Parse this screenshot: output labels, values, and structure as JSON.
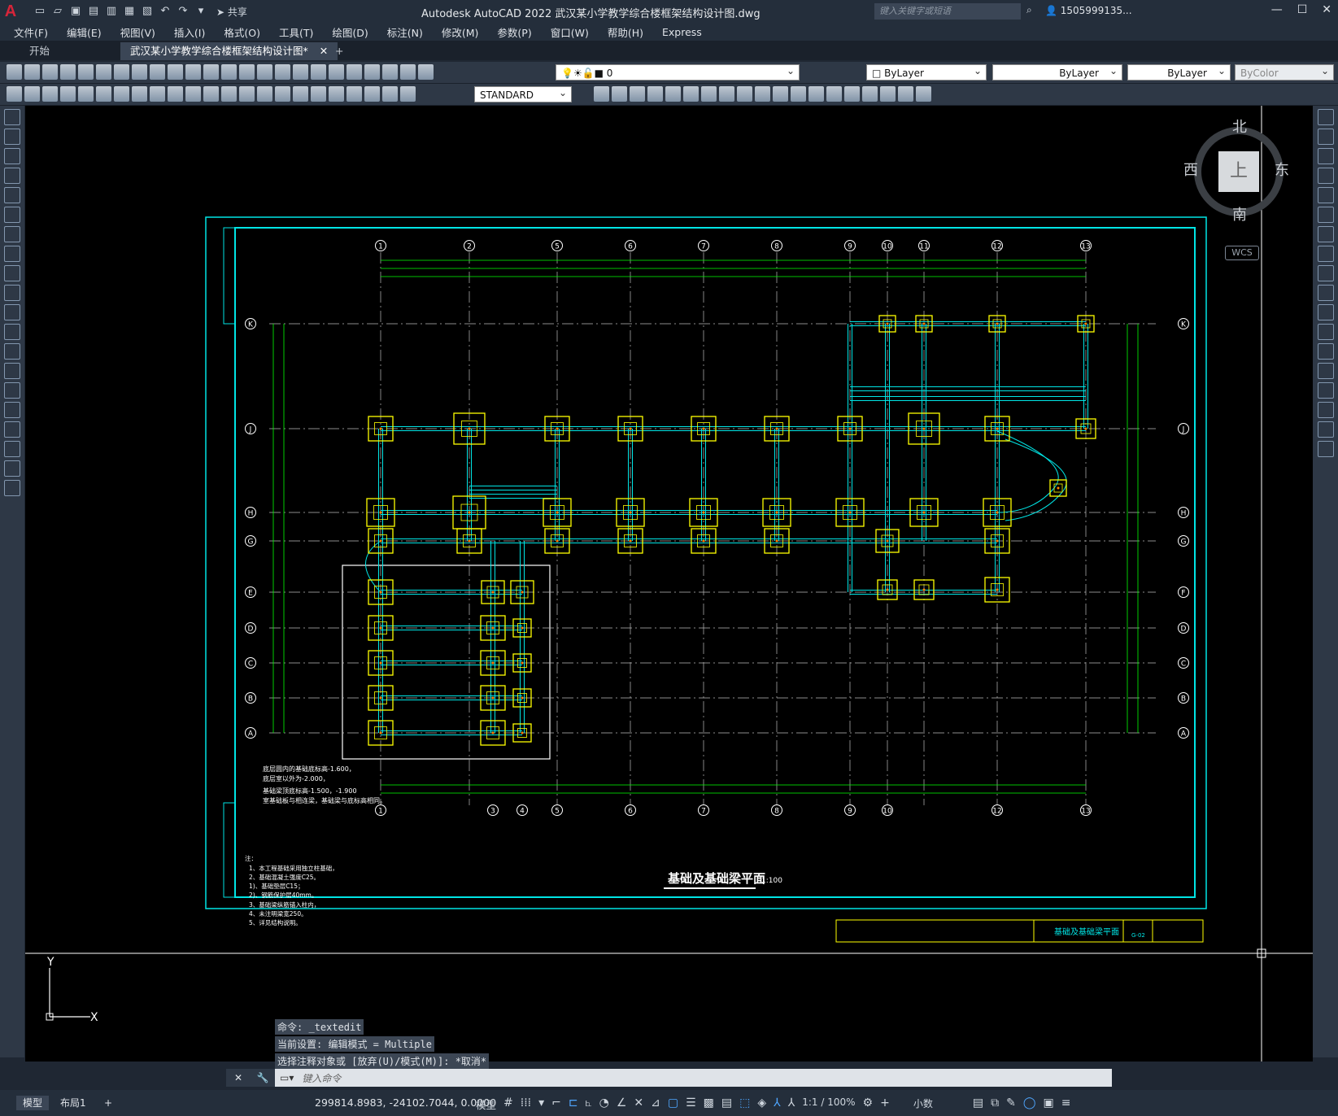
{
  "app": {
    "title": "Autodesk AutoCAD 2022    武汉某小学教学综合楼框架结构设计图.dwg",
    "logo": "A",
    "share_label": "共享",
    "search_placeholder": "键入关键字或短语",
    "user": "1505999135...",
    "window_controls": [
      "—",
      "☐",
      "✕"
    ]
  },
  "menu": [
    "文件(F)",
    "编辑(E)",
    "视图(V)",
    "插入(I)",
    "格式(O)",
    "工具(T)",
    "绘图(D)",
    "标注(N)",
    "修改(M)",
    "参数(P)",
    "窗口(W)",
    "帮助(H)",
    "Express"
  ],
  "tabs": {
    "start": "开始",
    "drawing": "武汉某小学教学综合楼框架结构设计图*",
    "close": "✕",
    "add": "+"
  },
  "properties": {
    "layer": "0",
    "color": "ByLayer",
    "linetype": "ByLayer",
    "lineweight": "ByLayer",
    "plotstyle": "ByColor",
    "textstyle": "STANDARD"
  },
  "viewcube": {
    "north": "北",
    "south": "南",
    "west": "西",
    "east": "东",
    "top": "上",
    "wcs": "WCS"
  },
  "drawing": {
    "title": "基础及基础梁平面",
    "scale": "1:100",
    "axis_top": [
      "1",
      "2",
      "5",
      "6",
      "7",
      "8",
      "9",
      "10",
      "11",
      "12",
      "13"
    ],
    "axis_bottom": [
      "1",
      "3",
      "4",
      "5",
      "6",
      "7",
      "8",
      "9",
      "10",
      "12",
      "13"
    ],
    "axis_rows": [
      "K",
      "J",
      "H",
      "G",
      "E",
      "D",
      "C",
      "B",
      "A"
    ],
    "axis_rows_right": [
      "K",
      "J",
      "H",
      "G",
      "F",
      "D",
      "C",
      "B",
      "A"
    ],
    "region_note": [
      "底层圆内的基础底标高-1.600，",
      "底层室以外为-2.000，",
      "基础梁顶底标高-1.500，-1.900",
      "室基础板与相连梁，基础梁与底标高相同。"
    ],
    "notes": [
      "注：",
      "1、本工程基础采用独立柱基础，",
      "2、基础混凝土强度C25。",
      "   1)、基础垫层C15；",
      "   2)、钢筋保护层40mm。",
      "3、基础梁纵筋锚入柱内，",
      "4、未注明梁宽250。",
      "5、详见结构说明。"
    ],
    "titleblock": {
      "name": "基础及基础梁平面",
      "sheet": "G-02"
    }
  },
  "command": {
    "history": [
      "命令: _textedit",
      "当前设置: 编辑模式 = Multiple",
      "选择注释对象或 [放弃(U)/模式(M)]: *取消*"
    ],
    "placeholder": "键入命令"
  },
  "ucs": {
    "y": "Y",
    "x": "X"
  },
  "status": {
    "model_tab": "模型",
    "layout_tab": "布局1",
    "add": "+",
    "coords": "299814.8983, -24102.7044, 0.0000",
    "mode": "模型",
    "scale": "1:1 / 100%",
    "units": "小数"
  },
  "colors": {
    "cyan": "#00e5e5",
    "green": "#00ff00",
    "yellow": "#ffff00",
    "magenta": "#ff00ff",
    "red": "#ff0000",
    "white": "#ffffff"
  }
}
